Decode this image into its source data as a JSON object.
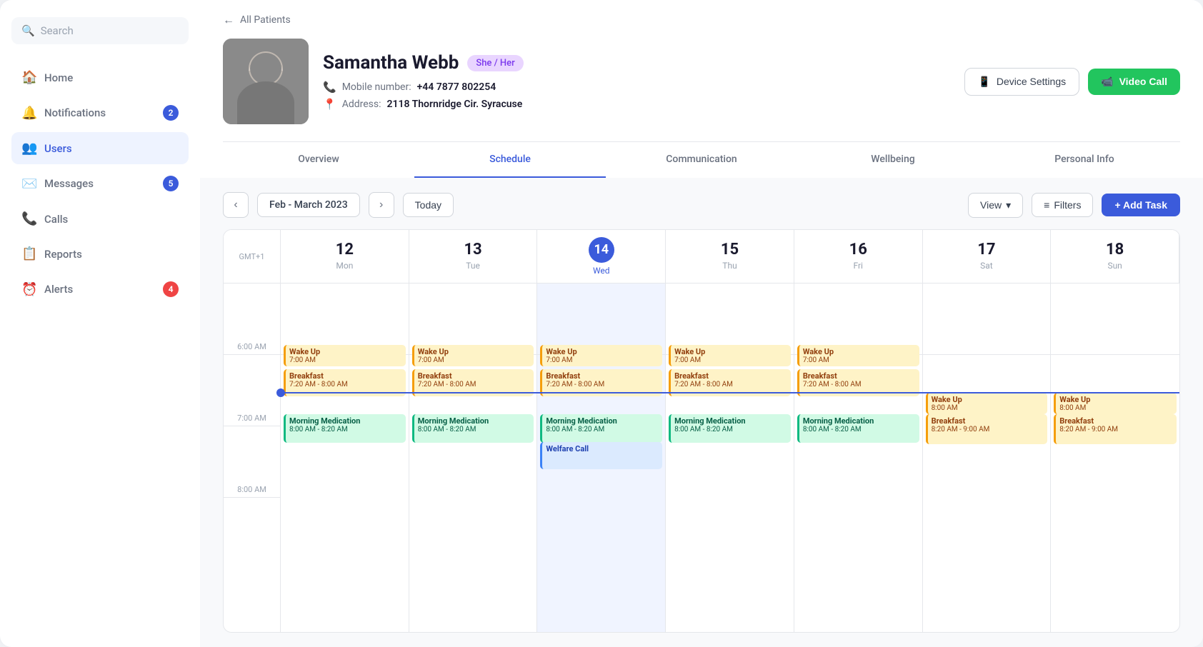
{
  "sidebar": {
    "search_placeholder": "Search",
    "nav_items": [
      {
        "id": "home",
        "label": "Home",
        "icon": "🏠",
        "badge": null,
        "active": false
      },
      {
        "id": "notifications",
        "label": "Notifications",
        "icon": "🔔",
        "badge": 2,
        "badge_color": "blue",
        "active": false
      },
      {
        "id": "users",
        "label": "Users",
        "icon": "👥",
        "badge": null,
        "active": true
      },
      {
        "id": "messages",
        "label": "Messages",
        "icon": "✉️",
        "badge": 5,
        "badge_color": "blue",
        "active": false
      },
      {
        "id": "calls",
        "label": "Calls",
        "icon": "📞",
        "badge": null,
        "active": false
      },
      {
        "id": "reports",
        "label": "Reports",
        "icon": "📋",
        "badge": null,
        "active": false
      },
      {
        "id": "alerts",
        "label": "Alerts",
        "icon": "⏰",
        "badge": 4,
        "badge_color": "red",
        "active": false
      }
    ]
  },
  "back_link": "All Patients",
  "patient": {
    "name": "Samantha Webb",
    "pronoun": "She / Her",
    "mobile_label": "Mobile number:",
    "mobile": "+44 7877 802254",
    "address_label": "Address:",
    "address": "2118 Thornridge Cir. Syracuse"
  },
  "buttons": {
    "device_settings": "Device Settings",
    "video_call": "Video Call"
  },
  "tabs": [
    {
      "id": "overview",
      "label": "Overview",
      "active": false
    },
    {
      "id": "schedule",
      "label": "",
      "active": true
    },
    {
      "id": "communication",
      "label": "Communication",
      "active": false
    },
    {
      "id": "wellbeing",
      "label": "Wellbeing",
      "active": false
    },
    {
      "id": "personal_info",
      "label": "Personal Info",
      "active": false
    }
  ],
  "calendar": {
    "date_range": "Feb - March 2023",
    "today_label": "Today",
    "view_label": "View",
    "filters_label": "Filters",
    "add_task_label": "+ Add Task",
    "timezone": "GMT+1",
    "days": [
      {
        "num": "12",
        "name": "Mon",
        "today": false
      },
      {
        "num": "13",
        "name": "Tue",
        "today": false
      },
      {
        "num": "14",
        "name": "Wed",
        "today": true
      },
      {
        "num": "15",
        "name": "Thu",
        "today": false
      },
      {
        "num": "16",
        "name": "Fri",
        "today": false
      },
      {
        "num": "17",
        "name": "Sat",
        "today": false
      },
      {
        "num": "18",
        "name": "Sun",
        "today": false
      }
    ],
    "time_labels": [
      "6:00 AM",
      "7:00 AM",
      "8:00 AM"
    ],
    "events": {
      "wake_up": {
        "title": "Wake Up",
        "time": "7:00 AM"
      },
      "breakfast": {
        "title": "Breakfast",
        "time": "7:20 AM - 8:00 AM"
      },
      "morning_med": {
        "title": "Morning Medication",
        "time": "8:00 AM - 8:20 AM"
      },
      "welfare_call": {
        "title": "Welfare Call",
        "time": ""
      },
      "wake_up_sat": {
        "title": "Wake Up",
        "time": "8:00 AM"
      },
      "breakfast_sat": {
        "title": "Breakfast",
        "time": "8:20 AM - 9:00 AM"
      }
    }
  }
}
